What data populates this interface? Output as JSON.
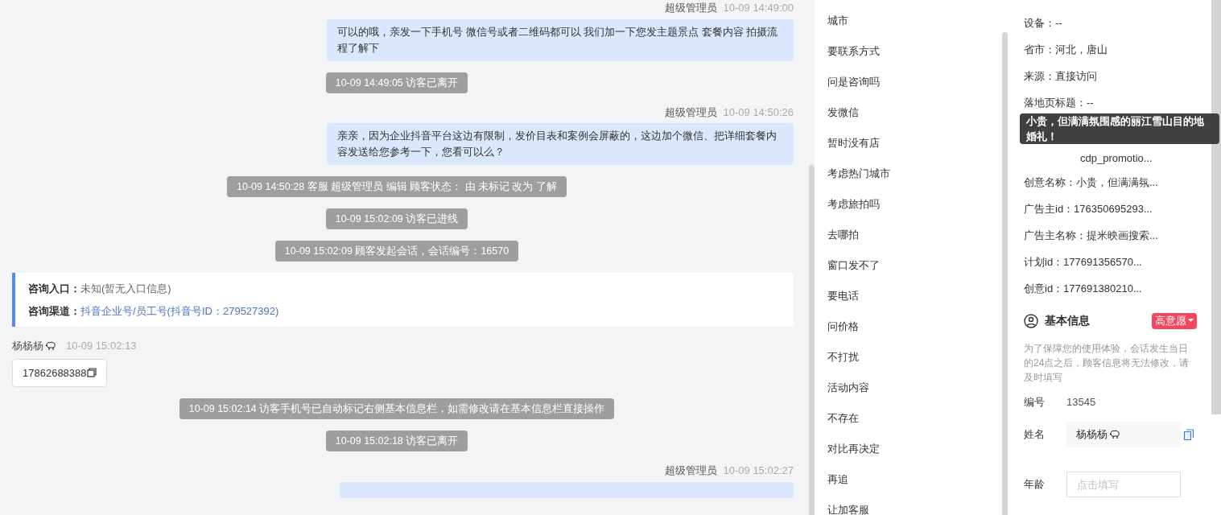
{
  "chat": {
    "messages": [
      {
        "kind": "agent_header",
        "sender": "超级管理员",
        "time": "10-09 14:49:00"
      },
      {
        "kind": "agent_bubble",
        "text": "可以的哦，亲发一下手机号 微信号或者二维码都可以 我们加一下您发主题景点 套餐内容 拍摄流程了解下"
      },
      {
        "kind": "system",
        "text": "10-09 14:49:05 访客已离开"
      },
      {
        "kind": "agent_header",
        "sender": "超级管理员",
        "time": "10-09 14:50:26"
      },
      {
        "kind": "agent_bubble",
        "text": "亲亲，因为企业抖音平台这边有限制，发价目表和案例会屏蔽的，这边加个微信、把详细套餐内容发送给您参考一下，您看可以么？"
      },
      {
        "kind": "system",
        "text": "10-09 14:50:28 客服 超级管理员 编辑 顾客状态： 由 未标记 改为 了解"
      },
      {
        "kind": "system",
        "text": "10-09 15:02:09 访客已进线"
      },
      {
        "kind": "system",
        "text": "10-09 15:02:09 顾客发起会话，会话编号：16570"
      },
      {
        "kind": "entry_card",
        "rows": [
          {
            "label": "咨询入口：",
            "value": "未知(暂无入口信息)",
            "link": false
          },
          {
            "label": "咨询渠道：",
            "value": "抖音企业号/员工号(抖音号ID：279527392)",
            "link": true
          }
        ]
      },
      {
        "kind": "visitor_header",
        "sender": "杨杨杨",
        "time": "10-09 15:02:13"
      },
      {
        "kind": "phone",
        "text": "17862688388"
      },
      {
        "kind": "system",
        "text": "10-09 15:02:14 访客手机号已自动标记右侧基本信息栏，如需修改请在基本信息栏直接操作"
      },
      {
        "kind": "system",
        "text": "10-09 15:02:18 访客已离开"
      },
      {
        "kind": "agent_header",
        "sender": "超级管理员",
        "time": "10-09 15:02:27"
      },
      {
        "kind": "agent_bubble_cut"
      }
    ]
  },
  "tags": [
    "城市",
    "要联系方式",
    "问是咨询吗",
    "发微信",
    "暂时没有店",
    "考虑热门城市",
    "考虑旅拍吗",
    "去哪拍",
    "窗口发不了",
    "要电话",
    "问价格",
    "不打扰",
    "活动内容",
    "不存在",
    "对比再决定",
    "再追",
    "让加客服"
  ],
  "profile": {
    "fields": [
      {
        "kind": "plain",
        "text": "设备：--"
      },
      {
        "kind": "plain",
        "text": "省市：河北，唐山"
      },
      {
        "kind": "plain",
        "text": "来源：直接访问"
      },
      {
        "kind": "plain",
        "text": "落地页标题：--"
      },
      {
        "kind": "covered"
      },
      {
        "kind": "covered_value",
        "text": "cdp_promotio..."
      },
      {
        "kind": "plain",
        "text": "创意名称：小贵，但满满氛..."
      },
      {
        "kind": "plain",
        "text": "广告主id：176350695293..."
      },
      {
        "kind": "plain",
        "text": "广告主名称：提米映画搜索..."
      },
      {
        "kind": "plain",
        "text": "计划id：177691356570..."
      },
      {
        "kind": "plain",
        "text": "创意id：177691380210..."
      }
    ],
    "tooltip": "小贵，但满满氛围感的丽江雪山目的地婚礼！"
  },
  "basic_info": {
    "title": "基本信息",
    "intent": "高意愿",
    "notice": "为了保障您的使用体验，会话发生当日的24点之后，顾客信息将无法修改，请及时填写",
    "fields": [
      {
        "kind": "text",
        "label": "编号",
        "value": "13545"
      },
      {
        "kind": "name",
        "label": "姓名",
        "value": "杨杨杨"
      },
      {
        "kind": "input",
        "label": "年龄",
        "placeholder": "点击填写"
      }
    ]
  }
}
